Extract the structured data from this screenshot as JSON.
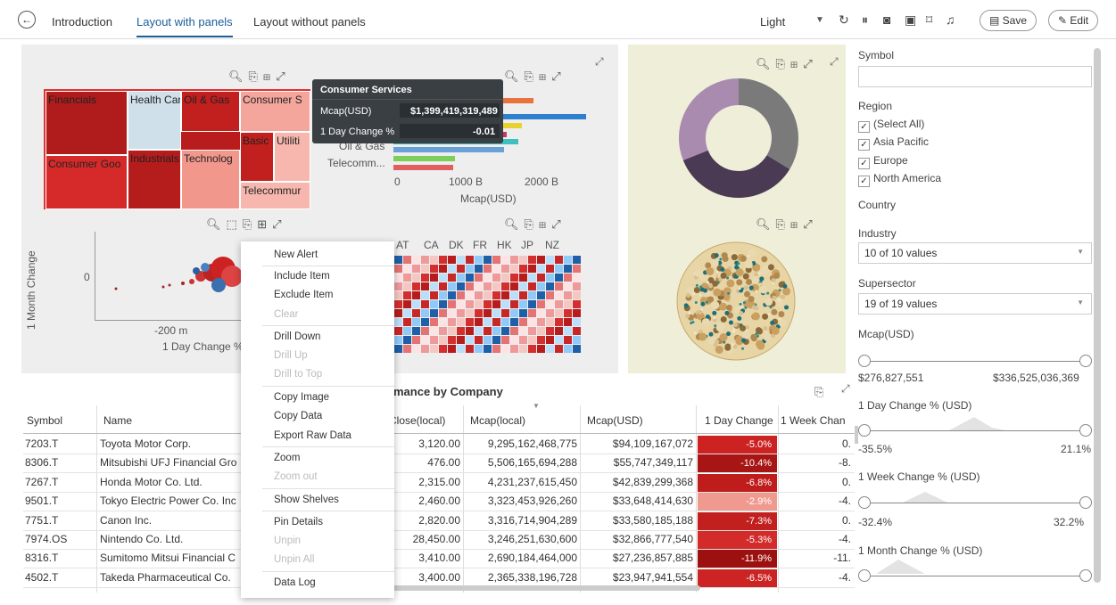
{
  "tabs": {
    "back": "←",
    "intro": "Introduction",
    "with_panels": "Layout with panels",
    "without_panels": "Layout without panels"
  },
  "toolbar": {
    "theme": "Light",
    "save": "Save",
    "edit": "Edit"
  },
  "treemap": {
    "cells": [
      "Financials",
      "Health Car",
      "Oil & Gas",
      "Consumer S",
      "Basic",
      "Utiliti",
      "Consumer Goo",
      "Industrials",
      "Technolog",
      "Telecommur"
    ]
  },
  "tooltip": {
    "title": "Consumer Services",
    "mcap_label": "Mcap(USD)",
    "mcap_value": "$1,399,419,319,489",
    "change_label": "1 Day Change %",
    "change_value": "-0.01"
  },
  "barchart": {
    "labels": [
      "Oil & Gas",
      "Telecomm..."
    ],
    "ticks": [
      "0",
      "1000 B",
      "2000 B"
    ],
    "xlabel": "Mcap(USD)",
    "tick_b": "B"
  },
  "scatter": {
    "ylabel": "1 Month Change",
    "ytick": "0",
    "xtick": "-200 m",
    "xlabel": "1 Day Change %"
  },
  "heatmap": {
    "cols": [
      "AT",
      "CA",
      "DK",
      "FR",
      "HK",
      "JP",
      "NZ"
    ]
  },
  "context_menu": {
    "new_alert": "New Alert",
    "include": "Include Item",
    "exclude": "Exclude Item",
    "clear": "Clear",
    "drill_down": "Drill Down",
    "drill_up": "Drill Up",
    "drill_top": "Drill to Top",
    "copy_image": "Copy Image",
    "copy_data": "Copy Data",
    "export_raw": "Export Raw Data",
    "zoom": "Zoom",
    "zoom_out": "Zoom out",
    "show_shelves": "Show Shelves",
    "pin_details": "Pin Details",
    "unpin": "Unpin",
    "unpin_all": "Unpin All",
    "data_log": "Data Log"
  },
  "table": {
    "title": "ormance by Company",
    "headers": [
      "Symbol",
      "Name",
      "Close(local)",
      "Mcap(local)",
      "Mcap(USD)",
      "1 Day Change",
      "1 Week Chan"
    ],
    "rows": [
      {
        "symbol": "7203.T",
        "name": "Toyota Motor Corp.",
        "close": "3,120.00",
        "mcap_local": "9,295,162,468,775",
        "mcap_usd": "$94,109,167,072",
        "day": "-5.0%",
        "week": "0."
      },
      {
        "symbol": "8306.T",
        "name": "Mitsubishi UFJ Financial Gro",
        "close": "476.00",
        "mcap_local": "5,506,165,694,288",
        "mcap_usd": "$55,747,349,117",
        "day": "-10.4%",
        "week": "-8."
      },
      {
        "symbol": "7267.T",
        "name": "Honda Motor Co. Ltd.",
        "close": "2,315.00",
        "mcap_local": "4,231,237,615,450",
        "mcap_usd": "$42,839,299,368",
        "day": "-6.8%",
        "week": "0."
      },
      {
        "symbol": "9501.T",
        "name": "Tokyo Electric Power Co. Inc",
        "close": "2,460.00",
        "mcap_local": "3,323,453,926,260",
        "mcap_usd": "$33,648,414,630",
        "day": "-2.9%",
        "week": "-4."
      },
      {
        "symbol": "7751.T",
        "name": "Canon Inc.",
        "close": "2,820.00",
        "mcap_local": "3,316,714,904,289",
        "mcap_usd": "$33,580,185,188",
        "day": "-7.3%",
        "week": "0."
      },
      {
        "symbol": "7974.OS",
        "name": "Nintendo Co. Ltd.",
        "close": "28,450.00",
        "mcap_local": "3,246,251,630,600",
        "mcap_usd": "$32,866,777,540",
        "day": "-5.3%",
        "week": "-4."
      },
      {
        "symbol": "8316.T",
        "name": "Sumitomo Mitsui Financial C",
        "close": "3,410.00",
        "mcap_local": "2,690,184,464,000",
        "mcap_usd": "$27,236,857,885",
        "day": "-11.9%",
        "week": "-11."
      },
      {
        "symbol": "4502.T",
        "name": "Takeda Pharmaceutical Co.",
        "close": "3,400.00",
        "mcap_local": "2,365,338,196,728",
        "mcap_usd": "$23,947,941,554",
        "day": "-6.5%",
        "week": "-4."
      }
    ]
  },
  "filters": {
    "symbol": "Symbol",
    "region": "Region",
    "region_items": [
      "(Select All)",
      "Asia Pacific",
      "Europe",
      "North America"
    ],
    "country": "Country",
    "industry": "Industry",
    "industry_value": "10 of 10 values",
    "supersector": "Supersector",
    "supersector_value": "19 of 19 values",
    "mcap": "Mcap(USD)",
    "mcap_min": "$276,827,551",
    "mcap_max": "$336,525,036,369",
    "day": "1 Day Change % (USD)",
    "day_min": "-35.5%",
    "day_max": "21.1%",
    "week": "1 Week Change % (USD)",
    "week_min": "-32.4%",
    "week_max": "32.2%",
    "month": "1 Month Change % (USD)"
  },
  "colors": {
    "accent": "#1b5e99",
    "treemap_dark": "#b81c1c",
    "treemap_light": "#f4a69c",
    "donut_purple": "#a98bb0",
    "donut_gray": "#7a7a7a",
    "donut_dark": "#4b3a53"
  }
}
